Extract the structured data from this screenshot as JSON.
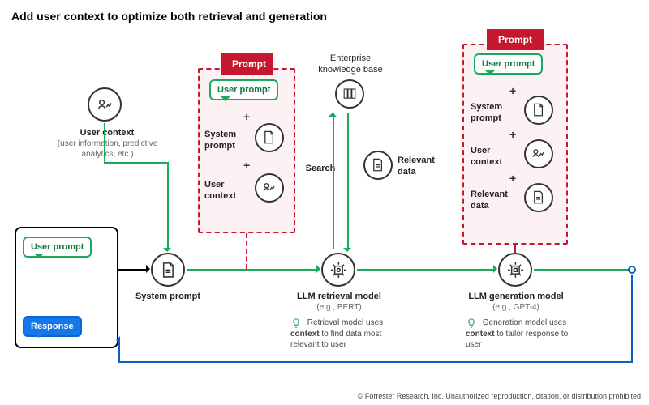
{
  "title": "Add user context to optimize both retrieval and generation",
  "footer": "© Forrester Research, Inc. Unauthorized reproduction, citation, or distribution prohibited",
  "user_context": {
    "label": "User context",
    "sub": "(user information, predictive analytics, etc.)"
  },
  "chat": {
    "user_prompt": "User prompt",
    "response": "Response"
  },
  "system_prompt_label": "System prompt",
  "prompt1": {
    "tag": "Prompt",
    "bubble": "User prompt",
    "system": "System prompt",
    "user_ctx": "User context"
  },
  "llm_retrieval": {
    "label": "LLM retrieval model",
    "sub": "(e.g., BERT)",
    "hint": "Retrieval model uses context to find data most relevant to user"
  },
  "enterprise": {
    "label": "Enterprise knowledge base",
    "search": "Search",
    "relevant": "Relevant data"
  },
  "prompt2": {
    "tag": "Prompt",
    "bubble": "User prompt",
    "system": "System prompt",
    "user_ctx": "User context",
    "relevant": "Relevant data"
  },
  "llm_gen": {
    "label": "LLM generation model",
    "sub": "(e.g., GPT-4)",
    "hint": "Generation model uses context to tailor response to user"
  },
  "icons": {
    "user_ctx": "user-chart-icon",
    "doc": "document-icon",
    "docs": "documents-icon",
    "chip": "chip-icon",
    "bulb": "bulb-icon"
  }
}
